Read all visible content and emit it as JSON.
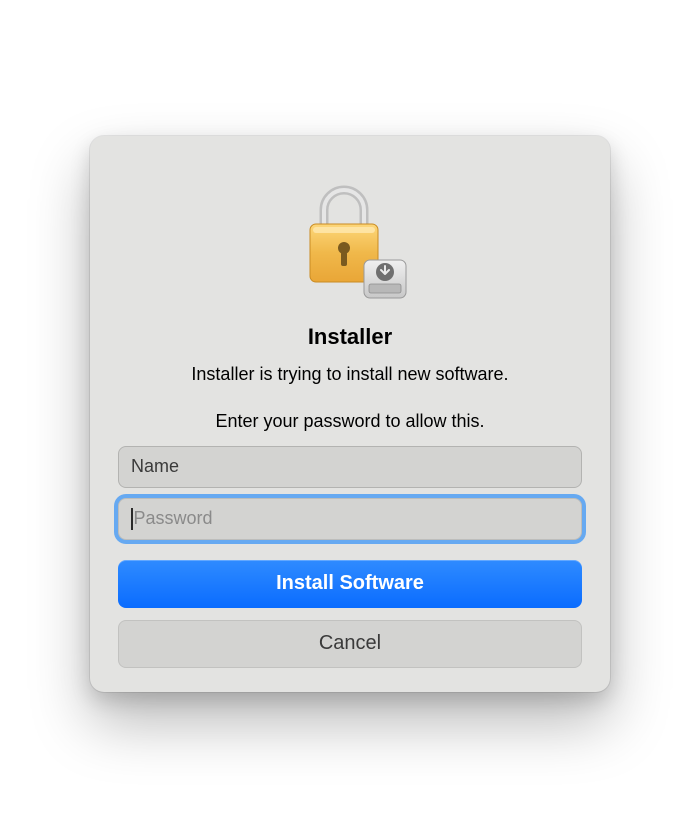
{
  "dialog": {
    "title": "Installer",
    "message": "Installer is trying to install new software.",
    "instruction": "Enter your password to allow this.",
    "name_field": {
      "label": "Name"
    },
    "password_field": {
      "placeholder": "Password"
    },
    "primary_button": "Install Software",
    "secondary_button": "Cancel"
  }
}
